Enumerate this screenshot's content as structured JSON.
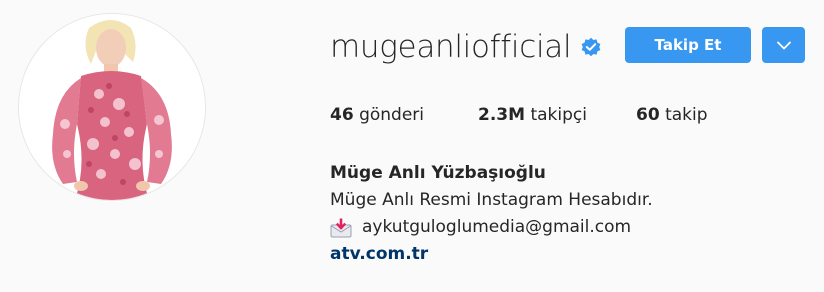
{
  "profile": {
    "username": "mugeanliofficial",
    "verified": true,
    "follow_label": "Takip Et",
    "stats": [
      {
        "count": "46",
        "label": "gönderi"
      },
      {
        "count": "2.3M",
        "label": "takipçi"
      },
      {
        "count": "60",
        "label": "takip"
      }
    ],
    "full_name": "Müge Anlı Yüzbaşıoğlu",
    "bio_line": "Müge Anlı Resmi Instagram Hesabıdır.",
    "email": "aykutguloglumedia@gmail.com",
    "website": "atv.com.tr"
  },
  "icons": {
    "verified": "verified-badge-icon",
    "dropdown": "chevron-down-icon",
    "mail": "incoming-envelope-icon"
  },
  "colors": {
    "button_blue": "#3897f0",
    "verified_blue": "#3897f0",
    "link_navy": "#003569",
    "text": "#262626"
  }
}
